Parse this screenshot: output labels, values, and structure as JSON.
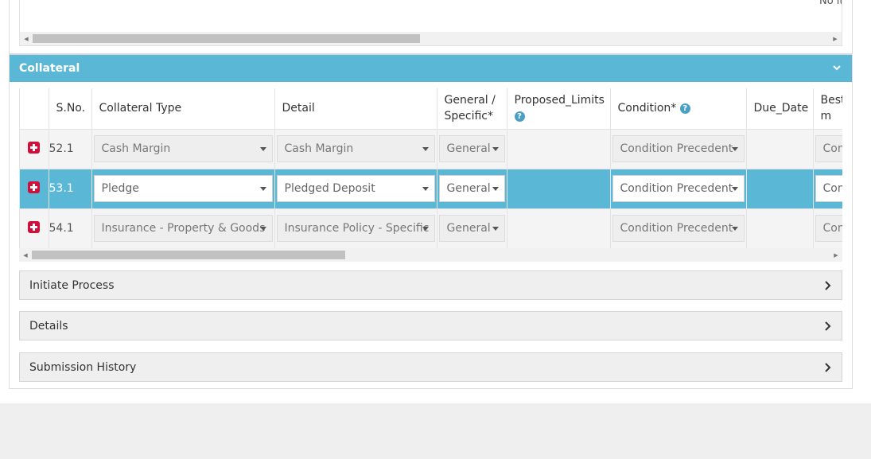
{
  "top_table": {
    "no_items_text": "No items to display"
  },
  "collateral": {
    "title": "Collateral",
    "columns": [
      {
        "label": ""
      },
      {
        "label": "S.No."
      },
      {
        "label": "Collateral Type"
      },
      {
        "label": "Detail"
      },
      {
        "label": "General / Specific*"
      },
      {
        "label": "Proposed_Limits"
      },
      {
        "label": "Condition*"
      },
      {
        "label": "Due_Date"
      },
      {
        "label": "Best Com"
      }
    ],
    "rows": [
      {
        "sno": "52.1",
        "collateral_type": "Cash Margin",
        "detail": "Cash Margin",
        "gen_spec": "General",
        "proposed_limits": "",
        "condition": "Condition Precedent",
        "due_date": "",
        "best": "Com"
      },
      {
        "sno": "53.1",
        "collateral_type": "Pledge",
        "detail": "Pledged Deposit",
        "gen_spec": "General",
        "proposed_limits": "",
        "condition": "Condition Precedent",
        "due_date": "",
        "best": "Com"
      },
      {
        "sno": "54.1",
        "collateral_type": "Insurance - Property & Goods",
        "detail": "Insurance Policy - Specific",
        "gen_spec": "General",
        "proposed_limits": "",
        "condition": "Condition Precedent",
        "due_date": "",
        "best": "Com"
      }
    ]
  },
  "panels": [
    {
      "label": "Initiate Process"
    },
    {
      "label": "Details"
    },
    {
      "label": "Submission History"
    }
  ],
  "colors": {
    "accent": "#5bb7d6",
    "add_icon": "#d0103a",
    "help_icon": "#4a9fc6"
  }
}
